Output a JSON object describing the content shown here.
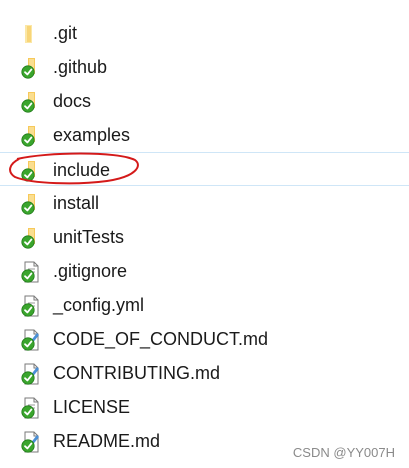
{
  "files": [
    {
      "name": ".git",
      "type": "folder-plain",
      "icon": "folder-icon"
    },
    {
      "name": ".github",
      "type": "folder-synced",
      "icon": "synced-folder-icon"
    },
    {
      "name": "docs",
      "type": "folder-synced",
      "icon": "synced-folder-icon"
    },
    {
      "name": "examples",
      "type": "folder-synced",
      "icon": "synced-folder-icon"
    },
    {
      "name": "include",
      "type": "folder-synced",
      "icon": "synced-folder-icon",
      "hovered": true
    },
    {
      "name": "install",
      "type": "folder-synced",
      "icon": "synced-folder-icon"
    },
    {
      "name": "unitTests",
      "type": "folder-synced",
      "icon": "synced-folder-icon"
    },
    {
      "name": ".gitignore",
      "type": "file-synced",
      "icon": "synced-file-icon"
    },
    {
      "name": "_config.yml",
      "type": "file-synced",
      "icon": "synced-file-icon"
    },
    {
      "name": "CODE_OF_CONDUCT.md",
      "type": "md-synced",
      "icon": "synced-markdown-file-icon"
    },
    {
      "name": "CONTRIBUTING.md",
      "type": "md-synced",
      "icon": "synced-markdown-file-icon"
    },
    {
      "name": "LICENSE",
      "type": "file-synced",
      "icon": "synced-file-icon"
    },
    {
      "name": "README.md",
      "type": "md-synced",
      "icon": "synced-markdown-file-icon"
    }
  ],
  "watermark": "CSDN @YY007H",
  "colors": {
    "folder": "#f7c95a",
    "folder_light": "#fbe7a6",
    "sync_badge": "#3aa52d",
    "annotation": "#d41a1a",
    "hover_border": "#cfe6f7"
  }
}
